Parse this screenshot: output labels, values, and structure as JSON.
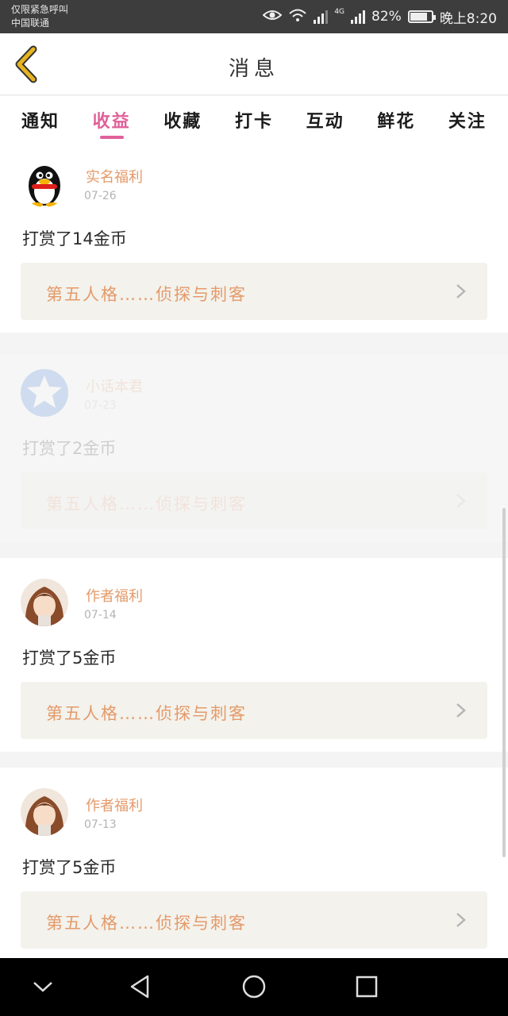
{
  "status_bar": {
    "carrier_line1": "仅限紧急呼叫",
    "carrier_line2": "中国联通",
    "network_label": "4G",
    "battery_percent": "82%",
    "battery_level": 0.82,
    "time": "晚上8:20"
  },
  "header": {
    "title": "消息"
  },
  "tabs": [
    {
      "label": "通知",
      "active": false
    },
    {
      "label": "收益",
      "active": true
    },
    {
      "label": "收藏",
      "active": false
    },
    {
      "label": "打卡",
      "active": false
    },
    {
      "label": "互动",
      "active": false
    },
    {
      "label": "鲜花",
      "active": false
    },
    {
      "label": "关注",
      "active": false
    }
  ],
  "messages": [
    {
      "user": "实名福利",
      "date": "07-26",
      "text": "打赏了14金币",
      "link": "第五人格……侦探与刺客",
      "avatar": "qq-penguin-icon"
    },
    {
      "user": "小话本君",
      "date": "07-23",
      "text": "打赏了2金币",
      "link": "第五人格……侦探与刺客",
      "avatar": "app-logo-icon"
    },
    {
      "user": "作者福利",
      "date": "07-14",
      "text": "打赏了5金币",
      "link": "第五人格……侦探与刺客",
      "avatar": "anime-avatar-icon"
    },
    {
      "user": "作者福利",
      "date": "07-13",
      "text": "打赏了5金币",
      "link": "第五人格……侦探与刺客",
      "avatar": "anime-avatar-icon"
    }
  ],
  "colors": {
    "accent": "#e0609a",
    "link_text": "#e49a6a",
    "back_icon": "#d4a017"
  }
}
